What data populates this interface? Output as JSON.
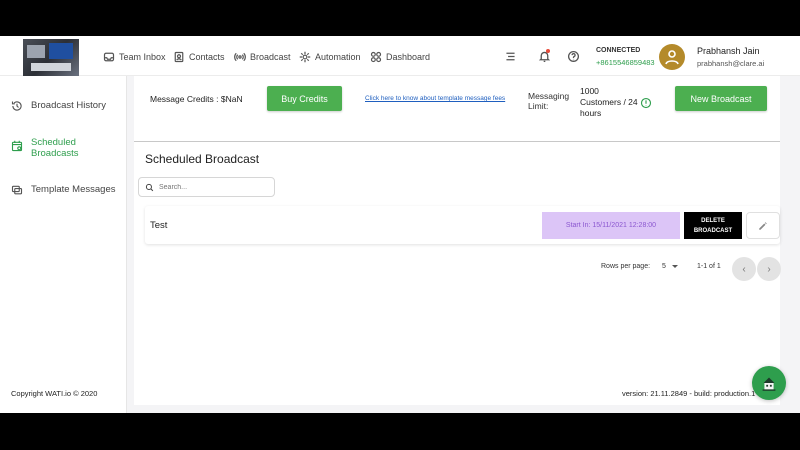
{
  "nav": {
    "items": [
      {
        "label": "Team Inbox",
        "icon": "inbox-icon"
      },
      {
        "label": "Contacts",
        "icon": "contacts-icon"
      },
      {
        "label": "Broadcast",
        "icon": "broadcast-icon"
      },
      {
        "label": "Automation",
        "icon": "automation-icon"
      },
      {
        "label": "Dashboard",
        "icon": "dashboard-icon"
      }
    ]
  },
  "status": {
    "connection": "CONNECTED",
    "phone": "+8615546859483"
  },
  "user": {
    "name": "Prabhansh Jain",
    "email": "prabhansh@clare.ai"
  },
  "sidebar": {
    "items": [
      {
        "label": "Broadcast History",
        "icon": "history-icon"
      },
      {
        "label": "Scheduled Broadcasts",
        "icon": "calendar-icon"
      },
      {
        "label": "Template Messages",
        "icon": "template-icon"
      }
    ],
    "active_index": 1,
    "copyright": "Copyright WATI.io © 2020"
  },
  "main": {
    "credits_label": "Message Credits",
    "credits_value": ": $NaN",
    "buy_credits": "Buy Credits",
    "fees_link": "Click here to know about template message fees",
    "limit_label": "Messaging Limit:",
    "limit_value": "1000 Customers / 24 hours",
    "new_broadcast": "New Broadcast",
    "section_title": "Scheduled Broadcast",
    "search_placeholder": "Search...",
    "rows": [
      {
        "name": "Test",
        "schedule": "Start In: 15/11/2021 12:28:00",
        "delete_label": "DELETE BROADCAST"
      }
    ],
    "pagination": {
      "rows_per_page_label": "Rows per page:",
      "rows_per_page": "5",
      "range": "1-1 of 1"
    }
  },
  "footer": {
    "version": "version: 21.11.2849 - build: production.1"
  },
  "colors": {
    "accent": "#4caf50",
    "active": "#2e9e4d",
    "chip_bg": "#dcc5f7",
    "chip_text": "#8b57d0"
  }
}
